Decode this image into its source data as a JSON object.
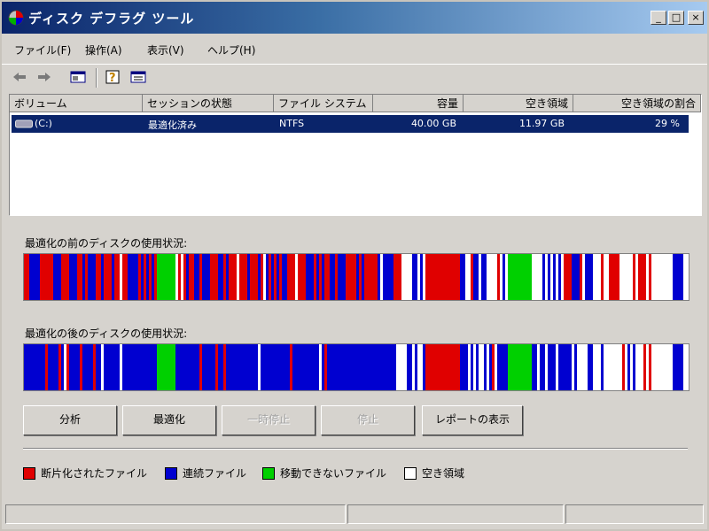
{
  "window": {
    "title": "ディスク デフラグ ツール",
    "controls": {
      "minimize": "_",
      "maximize": "□",
      "close": "×"
    }
  },
  "menu": [
    "ファイル(F)",
    "操作(A)",
    "表示(V)",
    "ヘルプ(H)"
  ],
  "toolbar": {
    "icons": [
      "back-arrow-icon",
      "forward-arrow-icon",
      "console-view-icon",
      "help-icon",
      "properties-icon"
    ]
  },
  "volumes": {
    "columns": [
      "ボリューム",
      "セッションの状態",
      "ファイル システム",
      "容量",
      "空き領域",
      "空き領域の割合"
    ],
    "rows": [
      {
        "volume": "(C:)",
        "status": "最適化済み",
        "fs": "NTFS",
        "capacity": "40.00 GB",
        "free": "11.97 GB",
        "free_pct": "29 %"
      }
    ]
  },
  "usage": {
    "before_label": "最適化の前のディスクの使用状況:",
    "after_label": "最適化の後のディスクの使用状況:"
  },
  "buttons": {
    "analyze": "分析",
    "defrag": "最適化",
    "pause": "一時停止",
    "stop": "停止",
    "report": "レポートの表示"
  },
  "legend": [
    {
      "label": "断片化されたファイル",
      "color": "#e00000"
    },
    {
      "label": "連続ファイル",
      "color": "#0000d0"
    },
    {
      "label": "移動できないファイル",
      "color": "#00d000"
    },
    {
      "label": "空き領域",
      "color": "#ffffff"
    }
  ],
  "colors": {
    "fragmented": "#e00000",
    "contiguous": "#0000d0",
    "unmovable": "#00d000",
    "free": "#ffffff",
    "selection": "#0a246a"
  }
}
